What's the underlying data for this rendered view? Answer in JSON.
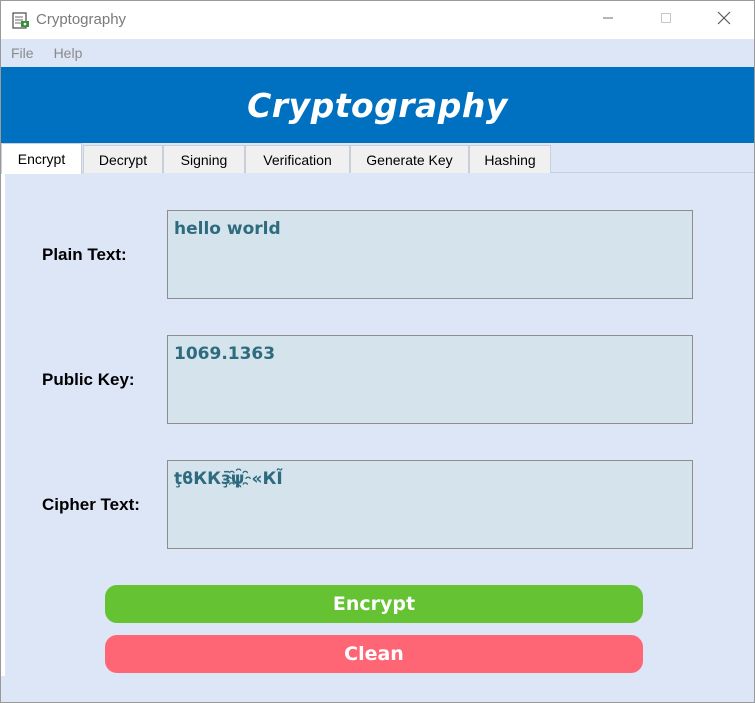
{
  "window": {
    "title": "Cryptography"
  },
  "menu": {
    "items": [
      {
        "label": "File"
      },
      {
        "label": "Help"
      }
    ]
  },
  "banner": {
    "title": "Cryptography"
  },
  "tabs": [
    {
      "label": "Encrypt",
      "active": true
    },
    {
      "label": "Decrypt",
      "active": false
    },
    {
      "label": "Signing",
      "active": false
    },
    {
      "label": "Verification",
      "active": false
    },
    {
      "label": "Generate Key",
      "active": false
    },
    {
      "label": "Hashing",
      "active": false
    }
  ],
  "form": {
    "plain_text": {
      "label": "Plain Text:",
      "value": "hello world"
    },
    "public_key": {
      "label": "Public Key:",
      "value": "1069.1363"
    },
    "cipher_text": {
      "label": "Cipher Text:",
      "value": "ţϐККҙ̄ψ҈«КĨ"
    }
  },
  "buttons": {
    "encrypt": "Encrypt",
    "clean": "Clean"
  },
  "colors": {
    "banner": "#0070c0",
    "background": "#dde6f7",
    "field_background": "#d5e3ec",
    "field_text": "#2e6b7e",
    "encrypt_button": "#64c233",
    "clean_button": "#ff6675"
  },
  "icons": {
    "app": "app-cryptography-icon",
    "minimize": "minimize-icon",
    "maximize": "maximize-icon",
    "close": "close-icon"
  }
}
